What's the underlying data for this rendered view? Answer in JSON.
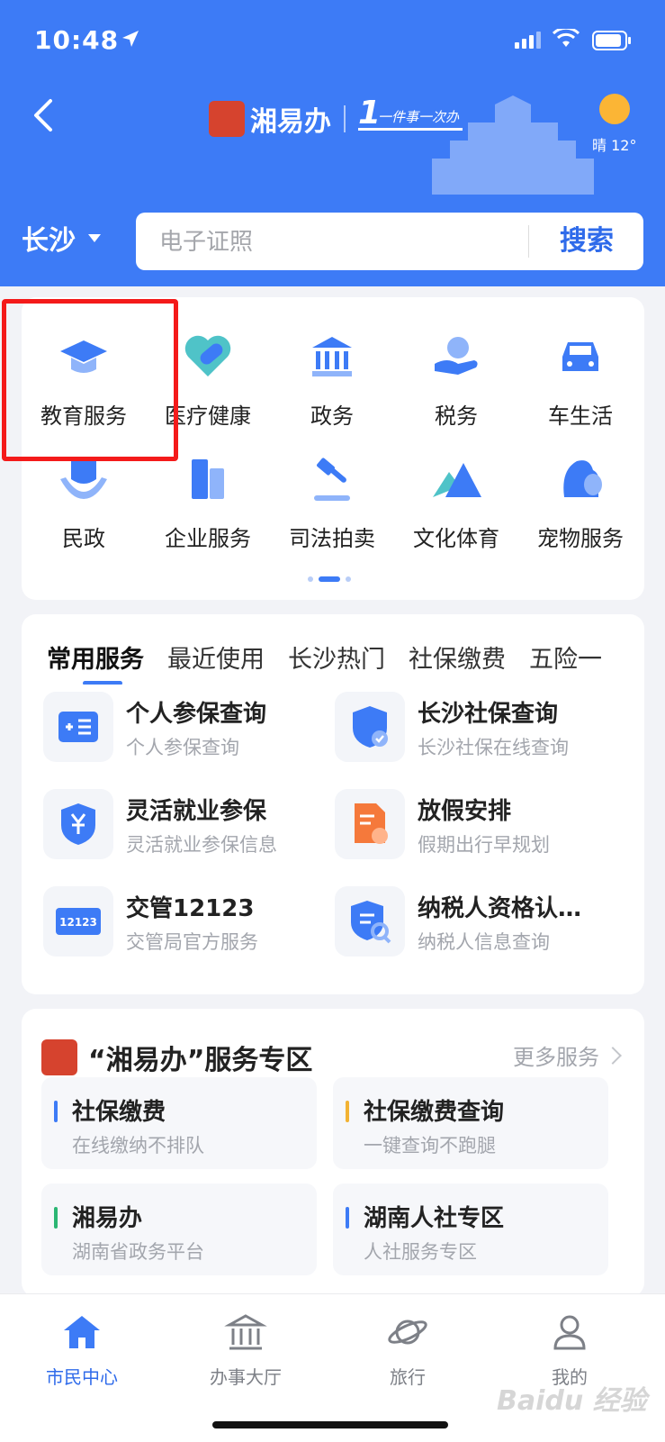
{
  "status_bar": {
    "time": "10:48"
  },
  "header": {
    "brand_name": "湘易办",
    "slogan": "一件事一次办",
    "slogan_one": "1",
    "weather": "晴 12°"
  },
  "search": {
    "city": "长沙",
    "placeholder": "电子证照",
    "button": "搜索"
  },
  "categories": [
    {
      "label": "教育服务",
      "icon": "graduation-cap-icon"
    },
    {
      "label": "医疗健康",
      "icon": "medical-heart-icon"
    },
    {
      "label": "政务",
      "icon": "government-building-icon"
    },
    {
      "label": "税务",
      "icon": "tax-hand-icon"
    },
    {
      "label": "车生活",
      "icon": "car-icon"
    },
    {
      "label": "民政",
      "icon": "civil-affairs-icon"
    },
    {
      "label": "企业服务",
      "icon": "enterprise-building-icon"
    },
    {
      "label": "司法拍卖",
      "icon": "gavel-icon"
    },
    {
      "label": "文化体育",
      "icon": "mountain-icon"
    },
    {
      "label": "宠物服务",
      "icon": "pet-icon"
    }
  ],
  "services": {
    "tabs": [
      "常用服务",
      "最近使用",
      "长沙热门",
      "社保缴费",
      "五险一"
    ],
    "items": [
      {
        "title": "个人参保查询",
        "sub": "个人参保查询",
        "icon": "id-card-icon"
      },
      {
        "title": "长沙社保查询",
        "sub": "长沙社保在线查询",
        "icon": "social-security-shield-icon"
      },
      {
        "title": "灵活就业参保",
        "sub": "灵活就业参保信息",
        "icon": "yuan-shield-icon"
      },
      {
        "title": "放假安排",
        "sub": "假期出行早规划",
        "icon": "holiday-document-icon"
      },
      {
        "title": "交管12123",
        "sub": "交管局官方服务",
        "icon": "traffic-12123-icon",
        "icon_text": "12123"
      },
      {
        "title": "纳税人资格认…",
        "sub": "纳税人信息查询",
        "icon": "taxpayer-search-icon"
      }
    ]
  },
  "zone": {
    "title": "“湘易办”服务专区",
    "more": "更多服务",
    "items": [
      {
        "title": "社保缴费",
        "sub": "在线缴纳不排队",
        "color": "#3d7bf6"
      },
      {
        "title": "社保缴费查询",
        "sub": "一键查询不跑腿",
        "color": "#f2b233"
      },
      {
        "title": "湘易办",
        "sub": "湖南省政务平台",
        "color": "#2bb673"
      },
      {
        "title": "湖南人社专区",
        "sub": "人社服务专区",
        "color": "#3d7bf6"
      }
    ]
  },
  "tabbar": [
    {
      "label": "市民中心",
      "icon": "home-icon",
      "active": true
    },
    {
      "label": "办事大厅",
      "icon": "hall-building-icon"
    },
    {
      "label": "旅行",
      "icon": "planet-icon"
    },
    {
      "label": "我的",
      "icon": "user-icon"
    }
  ],
  "watermark": "Baidu 经验",
  "colors": {
    "primary": "#3d7bf6",
    "highlight": "#f41a1a",
    "brand_red": "#d6432e"
  }
}
